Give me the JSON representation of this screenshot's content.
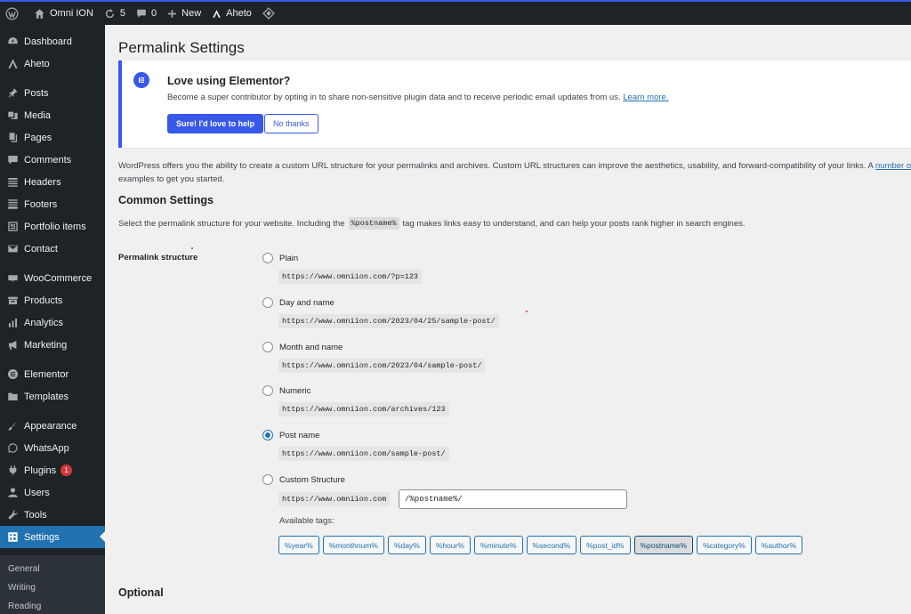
{
  "admin_bar": {
    "site_name": "Omni ION",
    "updates_count": "5",
    "comments_count": "0",
    "new_label": "New",
    "aheto_label": "Aheto"
  },
  "sidebar": {
    "groups": [
      [
        {
          "label": "Dashboard",
          "icon": "dashboard-icon"
        },
        {
          "label": "Aheto",
          "icon": "aheto-icon"
        }
      ],
      [
        {
          "label": "Posts",
          "icon": "pushpin-icon"
        },
        {
          "label": "Media",
          "icon": "media-icon"
        },
        {
          "label": "Pages",
          "icon": "pages-icon"
        },
        {
          "label": "Comments",
          "icon": "comment-icon"
        },
        {
          "label": "Headers",
          "icon": "headers-icon"
        },
        {
          "label": "Footers",
          "icon": "footers-icon"
        },
        {
          "label": "Portfolio items",
          "icon": "portfolio-icon"
        },
        {
          "label": "Contact",
          "icon": "mail-icon"
        }
      ],
      [
        {
          "label": "WooCommerce",
          "icon": "woocommerce-icon"
        },
        {
          "label": "Products",
          "icon": "products-icon"
        },
        {
          "label": "Analytics",
          "icon": "analytics-icon"
        },
        {
          "label": "Marketing",
          "icon": "megaphone-icon"
        }
      ],
      [
        {
          "label": "Elementor",
          "icon": "elementor-icon"
        },
        {
          "label": "Templates",
          "icon": "folder-icon"
        }
      ],
      [
        {
          "label": "Appearance",
          "icon": "brush-icon"
        },
        {
          "label": "WhatsApp",
          "icon": "whatsapp-icon"
        },
        {
          "label": "Plugins",
          "icon": "plugin-icon",
          "badge": "1"
        },
        {
          "label": "Users",
          "icon": "users-icon"
        },
        {
          "label": "Tools",
          "icon": "wrench-icon"
        },
        {
          "label": "Settings",
          "icon": "settings-icon",
          "active": true
        }
      ]
    ],
    "submenu": [
      "General",
      "Writing",
      "Reading"
    ]
  },
  "page": {
    "title": "Permalink Settings",
    "notice": {
      "title": "Love using Elementor?",
      "text": "Become a super contributor by opting in to share non-sensitive plugin data and to receive periodic email updates from us.",
      "link": "Learn more.",
      "primary_button": "Sure! I'd love to help",
      "secondary_button": "No thanks"
    },
    "intro_line1": "WordPress offers you the ability to create a custom URL structure for your permalinks and archives. Custom URL structures can improve the aesthetics, usability, and forward-compatibility of your links. A",
    "intro_link": "number o",
    "intro_line2": "examples to get you started.",
    "common_heading": "Common Settings",
    "common_desc_before": "Select the permalink structure for your website. Including the",
    "common_desc_code": "%postname%",
    "common_desc_after": "tag makes links easy to understand, and can help your posts rank higher in search engines.",
    "structure_label": "Permalink structure",
    "options": [
      {
        "label": "Plain",
        "example": "https://www.omniion.com/?p=123",
        "checked": false
      },
      {
        "label": "Day and name",
        "example": "https://www.omniion.com/2023/04/25/sample-post/",
        "checked": false
      },
      {
        "label": "Month and name",
        "example": "https://www.omniion.com/2023/04/sample-post/",
        "checked": false
      },
      {
        "label": "Numeric",
        "example": "https://www.omniion.com/archives/123",
        "checked": false
      },
      {
        "label": "Post name",
        "example": "https://www.omniion.com/sample-post/",
        "checked": true
      },
      {
        "label": "Custom Structure",
        "example": "https://www.omniion.com",
        "checked": false
      }
    ],
    "custom_structure_value": "/%postname%/",
    "available_tags_label": "Available tags:",
    "tags": [
      "%year%",
      "%monthnum%",
      "%day%",
      "%hour%",
      "%minute%",
      "%second%",
      "%post_id%",
      "%postname%",
      "%category%",
      "%author%"
    ],
    "active_tag": "%postname%",
    "optional_heading": "Optional"
  },
  "colors": {
    "admin_dark": "#1d2327",
    "accent_blue": "#2271b1",
    "elementor_blue": "#3858e9",
    "badge_red": "#d63638"
  }
}
